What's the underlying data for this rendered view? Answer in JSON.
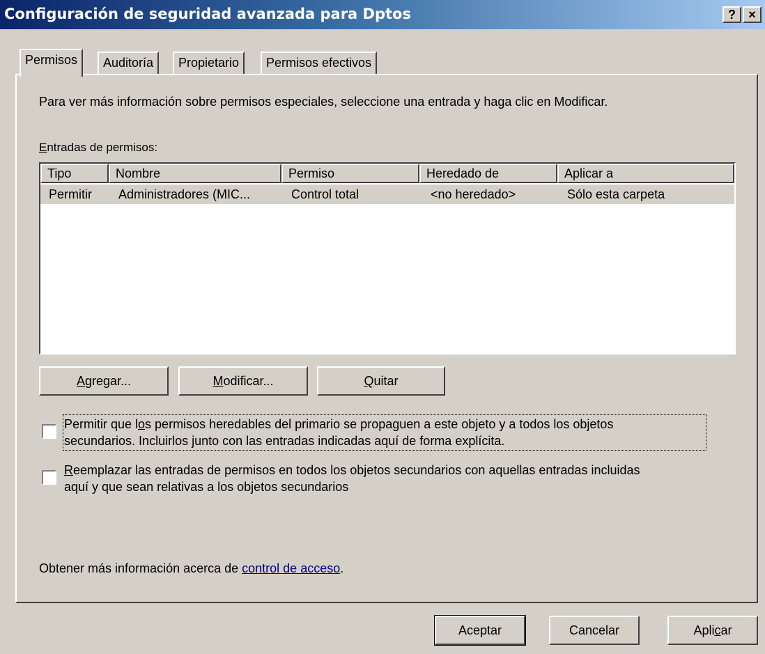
{
  "window": {
    "title": "Configuración de seguridad avanzada para Dptos",
    "help_label": "?",
    "close_label": "×"
  },
  "tabs": [
    {
      "label": "Permisos",
      "active": true
    },
    {
      "label": "Auditoría",
      "active": false
    },
    {
      "label": "Propietario",
      "active": false
    },
    {
      "label": "Permisos efectivos",
      "active": false
    }
  ],
  "info_text": "Para ver más información sobre permisos especiales, seleccione una entrada y haga clic en Modificar.",
  "entries": {
    "label_first": "E",
    "label_rest": "ntradas de permisos:",
    "columns": [
      "Tipo",
      "Nombre",
      "Permiso",
      "Heredado de",
      "Aplicar a"
    ],
    "rows": [
      {
        "tipo": "Permitir",
        "nombre": "Administradores (MIC...",
        "permiso": "Control total",
        "heredado": "<no heredado>",
        "aplicar": "Sólo esta carpeta"
      }
    ]
  },
  "buttons": {
    "agregar": {
      "pre": "",
      "mn": "A",
      "post": "gregar..."
    },
    "modificar": {
      "pre": "",
      "mn": "M",
      "post": "odificar..."
    },
    "quitar": {
      "pre": "",
      "mn": "Q",
      "post": "uitar"
    }
  },
  "checkboxes": {
    "inherit": {
      "checked": false,
      "line1_pre": "Permitir que l",
      "line1_mn": "o",
      "line1_post": "s permisos heredables del primario se propaguen a este objeto y a todos los objetos",
      "line2": "secundarios. Incluirlos junto con las entradas indicadas aquí de forma explícita."
    },
    "replace": {
      "checked": false,
      "line1_mn": "R",
      "line1_post": "eemplazar las entradas de permisos en todos los objetos secundarios con aquellas entradas incluidas",
      "line2": "aquí y que sean relativas a los objetos secundarios"
    }
  },
  "more_info": {
    "text": "Obtener más información acerca de ",
    "link": "control de acceso",
    "suffix": "."
  },
  "footer": {
    "ok": "Aceptar",
    "cancel": "Cancelar",
    "apply_pre": "Apli",
    "apply_mn": "c",
    "apply_post": "ar"
  }
}
